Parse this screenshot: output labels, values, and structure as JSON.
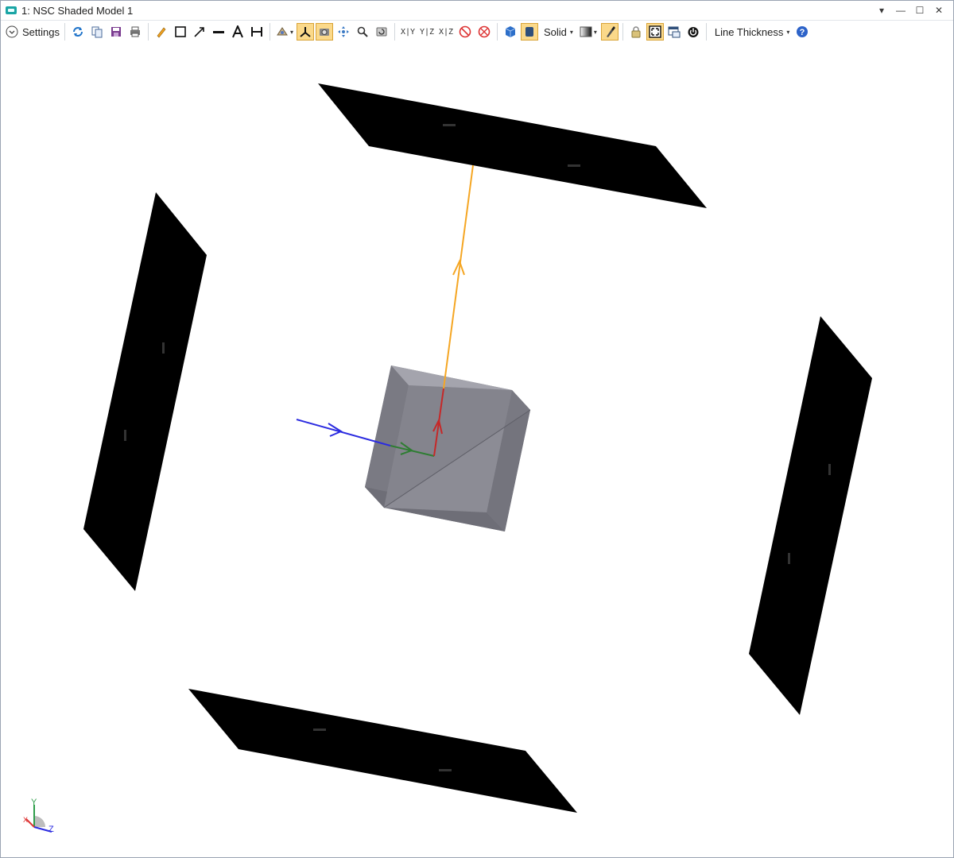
{
  "window": {
    "title": "1: NSC Shaded Model 1",
    "controls": [
      "chevron-down-icon",
      "minimize-icon",
      "maximize-icon",
      "close-icon"
    ]
  },
  "toolbar": {
    "settings_label": "Settings",
    "axis_views": [
      "X|Y",
      "Y|Z",
      "X|Z"
    ],
    "render_mode_label": "Solid",
    "line_thickness_label": "Line Thickness",
    "icons": [
      "refresh-icon",
      "copy-icon",
      "save-icon",
      "print-icon",
      "pencil-icon",
      "rectangle-icon",
      "arrow-icon",
      "line-icon",
      "text-icon",
      "dimension-icon",
      "lens-icon",
      "axes-icon",
      "camera-icon",
      "pan-icon",
      "zoom-icon",
      "reset-view-icon",
      "no-rotate-icon",
      "no-rays-icon",
      "cube-icon",
      "shaded-icon",
      "gradient-icon",
      "brush-icon",
      "lock-icon",
      "fit-icon",
      "window-icon",
      "power-icon",
      "help-icon"
    ],
    "active_tools": [
      "axes-icon",
      "camera-icon",
      "shaded-icon",
      "brush-icon",
      "fit-icon"
    ]
  },
  "viewport": {
    "axis_triad_labels": {
      "y": "Y",
      "z": "Z",
      "x": "X"
    },
    "colors": {
      "detector": "#000000",
      "cube": "#8a8a93",
      "ray_incident": "#2b2be0",
      "ray_green": "#2e7d32",
      "ray_red": "#c62828",
      "ray_reflected": "#f5a623"
    }
  }
}
